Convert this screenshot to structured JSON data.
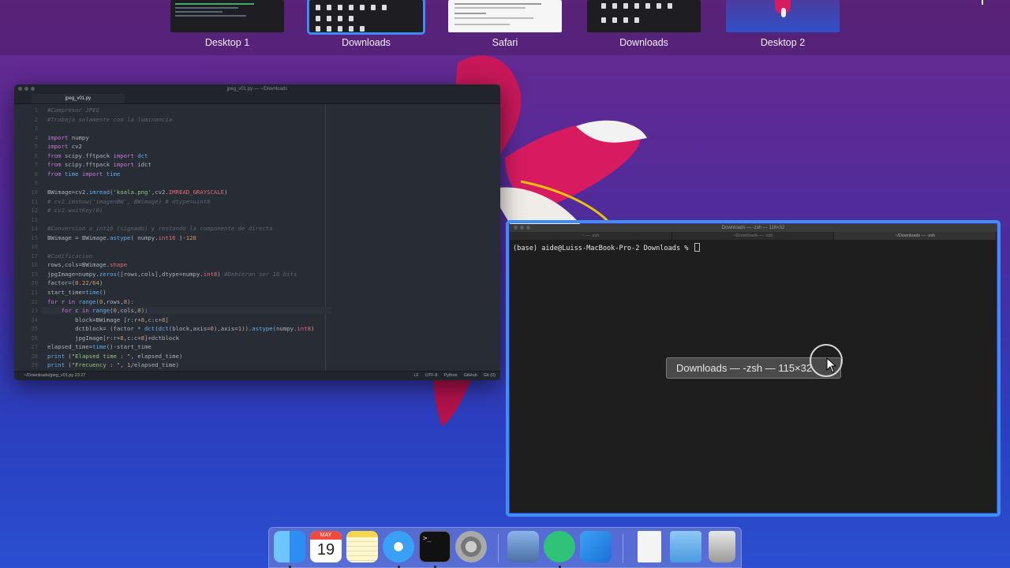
{
  "spaces": [
    {
      "label": "Desktop 1",
      "active": false
    },
    {
      "label": "Downloads",
      "active": true
    },
    {
      "label": "Safari",
      "active": false
    },
    {
      "label": "Downloads",
      "active": false
    },
    {
      "label": "Desktop 2",
      "active": false
    }
  ],
  "atom": {
    "window_title": "jpeg_v01.py — ~/Downloads",
    "tab_label": "jpeg_v01.py",
    "status_left": "~/Downloads/jpeg_v01.py   23:27",
    "status_items": [
      "LF",
      "UTF-8",
      "Python",
      "GitHub",
      "Git (0)"
    ],
    "lines": [
      "#Compresor JPEG",
      "#Trabaja solamente con la luminancia",
      "",
      "import numpy",
      "import cv2",
      "from scipy.fftpack import dct",
      "from scipy.fftpack import idct",
      "from time import time",
      "",
      "BWimage=cv2.imread('koala.png',cv2.IMREAD_GRAYSCALE)",
      "# cv2.imshow('imagenBW', BWimage) # dtype=uint8",
      "# cv2.waitKey(0)",
      "",
      "#Conversion a int16 (signado) y restando la componente de directa",
      "BWimage = BWimage.astype( numpy.int16 )-128",
      "",
      "#Codificacion",
      "rows,cols=BWimage.shape",
      "jpgImage=numpy.zeros([rows,cols],dtype=numpy.int8) #Debieran ser 16 bits",
      "factor=(0.22/64)",
      "start_time=time()",
      "for r in range(0,rows,8):",
      "    for c in range(0,cols,8):",
      "        block=BWimage [r:r+8,c:c+8]",
      "        dctblock= (factor * dct(dct(block,axis=0),axis=1)).astype(numpy.int8)",
      "        jpgImage[r:r+8,c:c+8]=dctblock",
      "elapsed_time=time()-start_time",
      "print (\"Elapsed time : \", elapsed_time)",
      "print (\"Frecuency : \", 1/elapsed_time)"
    ]
  },
  "terminal": {
    "window_title": "Downloads — -zsh — 116×32",
    "tabs": [
      "~ — -zsh",
      "~/Downloads — -zsh",
      "~/Downloads — -zsh"
    ],
    "prompt": "(base) aide@Luiss-MacBook-Pro-2 Downloads % ",
    "tooltip": "Downloads — -zsh — 115×32"
  },
  "dock": {
    "calendar_month": "MAY",
    "calendar_day": "19",
    "items": [
      "finder-icon",
      "calendar-icon",
      "notes-icon",
      "safari-icon",
      "terminal-icon",
      "system-preferences-icon",
      "preview-icon",
      "atom-icon",
      "xcode-icon",
      "document-icon",
      "downloads-folder-icon",
      "trash-icon"
    ]
  }
}
